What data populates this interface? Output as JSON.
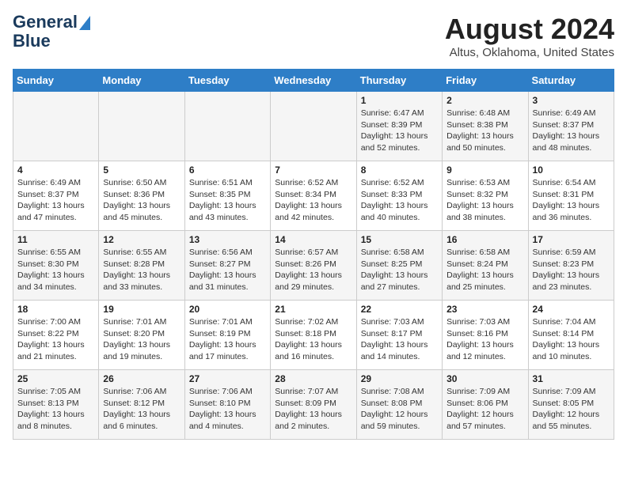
{
  "header": {
    "logo_line1": "General",
    "logo_line2": "Blue",
    "month_title": "August 2024",
    "location": "Altus, Oklahoma, United States"
  },
  "weekdays": [
    "Sunday",
    "Monday",
    "Tuesday",
    "Wednesday",
    "Thursday",
    "Friday",
    "Saturday"
  ],
  "weeks": [
    [
      {
        "day": "",
        "text": ""
      },
      {
        "day": "",
        "text": ""
      },
      {
        "day": "",
        "text": ""
      },
      {
        "day": "",
        "text": ""
      },
      {
        "day": "1",
        "text": "Sunrise: 6:47 AM\nSunset: 8:39 PM\nDaylight: 13 hours\nand 52 minutes."
      },
      {
        "day": "2",
        "text": "Sunrise: 6:48 AM\nSunset: 8:38 PM\nDaylight: 13 hours\nand 50 minutes."
      },
      {
        "day": "3",
        "text": "Sunrise: 6:49 AM\nSunset: 8:37 PM\nDaylight: 13 hours\nand 48 minutes."
      }
    ],
    [
      {
        "day": "4",
        "text": "Sunrise: 6:49 AM\nSunset: 8:37 PM\nDaylight: 13 hours\nand 47 minutes."
      },
      {
        "day": "5",
        "text": "Sunrise: 6:50 AM\nSunset: 8:36 PM\nDaylight: 13 hours\nand 45 minutes."
      },
      {
        "day": "6",
        "text": "Sunrise: 6:51 AM\nSunset: 8:35 PM\nDaylight: 13 hours\nand 43 minutes."
      },
      {
        "day": "7",
        "text": "Sunrise: 6:52 AM\nSunset: 8:34 PM\nDaylight: 13 hours\nand 42 minutes."
      },
      {
        "day": "8",
        "text": "Sunrise: 6:52 AM\nSunset: 8:33 PM\nDaylight: 13 hours\nand 40 minutes."
      },
      {
        "day": "9",
        "text": "Sunrise: 6:53 AM\nSunset: 8:32 PM\nDaylight: 13 hours\nand 38 minutes."
      },
      {
        "day": "10",
        "text": "Sunrise: 6:54 AM\nSunset: 8:31 PM\nDaylight: 13 hours\nand 36 minutes."
      }
    ],
    [
      {
        "day": "11",
        "text": "Sunrise: 6:55 AM\nSunset: 8:30 PM\nDaylight: 13 hours\nand 34 minutes."
      },
      {
        "day": "12",
        "text": "Sunrise: 6:55 AM\nSunset: 8:28 PM\nDaylight: 13 hours\nand 33 minutes."
      },
      {
        "day": "13",
        "text": "Sunrise: 6:56 AM\nSunset: 8:27 PM\nDaylight: 13 hours\nand 31 minutes."
      },
      {
        "day": "14",
        "text": "Sunrise: 6:57 AM\nSunset: 8:26 PM\nDaylight: 13 hours\nand 29 minutes."
      },
      {
        "day": "15",
        "text": "Sunrise: 6:58 AM\nSunset: 8:25 PM\nDaylight: 13 hours\nand 27 minutes."
      },
      {
        "day": "16",
        "text": "Sunrise: 6:58 AM\nSunset: 8:24 PM\nDaylight: 13 hours\nand 25 minutes."
      },
      {
        "day": "17",
        "text": "Sunrise: 6:59 AM\nSunset: 8:23 PM\nDaylight: 13 hours\nand 23 minutes."
      }
    ],
    [
      {
        "day": "18",
        "text": "Sunrise: 7:00 AM\nSunset: 8:22 PM\nDaylight: 13 hours\nand 21 minutes."
      },
      {
        "day": "19",
        "text": "Sunrise: 7:01 AM\nSunset: 8:20 PM\nDaylight: 13 hours\nand 19 minutes."
      },
      {
        "day": "20",
        "text": "Sunrise: 7:01 AM\nSunset: 8:19 PM\nDaylight: 13 hours\nand 17 minutes."
      },
      {
        "day": "21",
        "text": "Sunrise: 7:02 AM\nSunset: 8:18 PM\nDaylight: 13 hours\nand 16 minutes."
      },
      {
        "day": "22",
        "text": "Sunrise: 7:03 AM\nSunset: 8:17 PM\nDaylight: 13 hours\nand 14 minutes."
      },
      {
        "day": "23",
        "text": "Sunrise: 7:03 AM\nSunset: 8:16 PM\nDaylight: 13 hours\nand 12 minutes."
      },
      {
        "day": "24",
        "text": "Sunrise: 7:04 AM\nSunset: 8:14 PM\nDaylight: 13 hours\nand 10 minutes."
      }
    ],
    [
      {
        "day": "25",
        "text": "Sunrise: 7:05 AM\nSunset: 8:13 PM\nDaylight: 13 hours\nand 8 minutes."
      },
      {
        "day": "26",
        "text": "Sunrise: 7:06 AM\nSunset: 8:12 PM\nDaylight: 13 hours\nand 6 minutes."
      },
      {
        "day": "27",
        "text": "Sunrise: 7:06 AM\nSunset: 8:10 PM\nDaylight: 13 hours\nand 4 minutes."
      },
      {
        "day": "28",
        "text": "Sunrise: 7:07 AM\nSunset: 8:09 PM\nDaylight: 13 hours\nand 2 minutes."
      },
      {
        "day": "29",
        "text": "Sunrise: 7:08 AM\nSunset: 8:08 PM\nDaylight: 12 hours\nand 59 minutes."
      },
      {
        "day": "30",
        "text": "Sunrise: 7:09 AM\nSunset: 8:06 PM\nDaylight: 12 hours\nand 57 minutes."
      },
      {
        "day": "31",
        "text": "Sunrise: 7:09 AM\nSunset: 8:05 PM\nDaylight: 12 hours\nand 55 minutes."
      }
    ]
  ]
}
